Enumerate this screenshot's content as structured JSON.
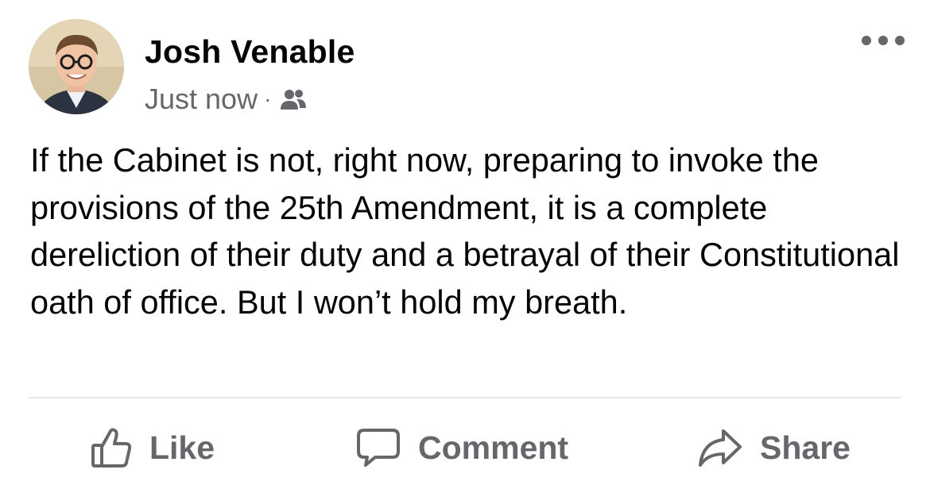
{
  "post": {
    "author_name": "Josh Venable",
    "timestamp": "Just now",
    "separator": "·",
    "audience_icon": "friends-icon",
    "more_icon": "more-horizontal-icon",
    "text": "If the Cabinet is not, right now, preparing to invoke the provisions of the 25th Amendment, it is a complete dereliction of their duty and a betrayal of their Constitutional oath of office. But I won’t hold my breath."
  },
  "actions": {
    "like_label": "Like",
    "like_icon": "thumbs-up-icon",
    "comment_label": "Comment",
    "comment_icon": "comment-bubble-icon",
    "share_label": "Share",
    "share_icon": "share-arrow-icon"
  },
  "colors": {
    "text_primary": "#050505",
    "text_secondary": "#65676b",
    "divider": "#e4e6eb",
    "background": "#ffffff"
  }
}
